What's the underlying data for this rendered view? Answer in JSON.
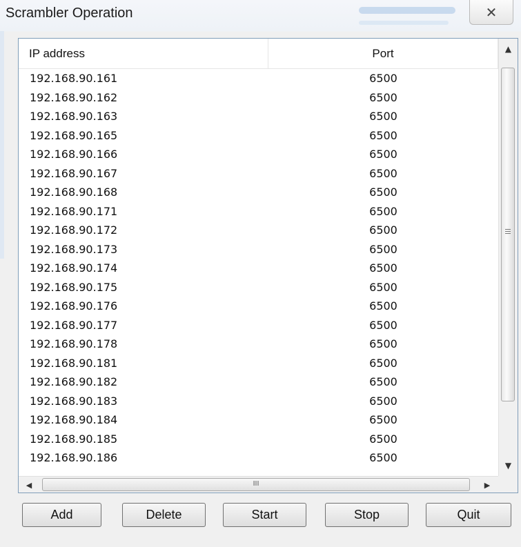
{
  "window": {
    "title": "Scrambler Operation",
    "close_glyph": "✕"
  },
  "table": {
    "columns": [
      "IP address",
      "Port"
    ],
    "rows": [
      {
        "ip": "192.168.90.161",
        "port": "6500"
      },
      {
        "ip": "192.168.90.162",
        "port": "6500"
      },
      {
        "ip": "192.168.90.163",
        "port": "6500"
      },
      {
        "ip": "192.168.90.165",
        "port": "6500"
      },
      {
        "ip": "192.168.90.166",
        "port": "6500"
      },
      {
        "ip": "192.168.90.167",
        "port": "6500"
      },
      {
        "ip": "192.168.90.168",
        "port": "6500"
      },
      {
        "ip": "192.168.90.171",
        "port": "6500"
      },
      {
        "ip": "192.168.90.172",
        "port": "6500"
      },
      {
        "ip": "192.168.90.173",
        "port": "6500"
      },
      {
        "ip": "192.168.90.174",
        "port": "6500"
      },
      {
        "ip": "192.168.90.175",
        "port": "6500"
      },
      {
        "ip": "192.168.90.176",
        "port": "6500"
      },
      {
        "ip": "192.168.90.177",
        "port": "6500"
      },
      {
        "ip": "192.168.90.178",
        "port": "6500"
      },
      {
        "ip": "192.168.90.181",
        "port": "6500"
      },
      {
        "ip": "192.168.90.182",
        "port": "6500"
      },
      {
        "ip": "192.168.90.183",
        "port": "6500"
      },
      {
        "ip": "192.168.90.184",
        "port": "6500"
      },
      {
        "ip": "192.168.90.185",
        "port": "6500"
      },
      {
        "ip": "192.168.90.186",
        "port": "6500"
      }
    ]
  },
  "scrollbars": {
    "up": "▲",
    "down": "▼",
    "left": "◀",
    "right": "▶",
    "h_grip": "III"
  },
  "buttons": {
    "add": "Add",
    "delete": "Delete",
    "start": "Start",
    "stop": "Stop",
    "quit": "Quit"
  }
}
